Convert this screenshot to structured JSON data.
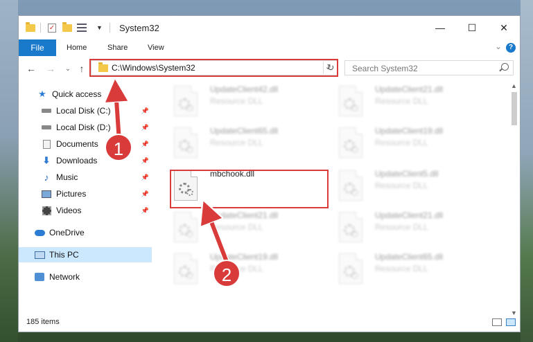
{
  "window": {
    "title": "System32",
    "minimize": "—",
    "maximize": "☐",
    "close": "✕"
  },
  "ribbon": {
    "file": "File",
    "home": "Home",
    "share": "Share",
    "view": "View",
    "help": "?"
  },
  "nav": {
    "address": "C:\\Windows\\System32",
    "search_placeholder": "Search System32"
  },
  "sidebar": {
    "items": [
      {
        "label": "Quick access",
        "icon": "star-icon"
      },
      {
        "label": "Local Disk (C:)",
        "icon": "drive-icon",
        "pinned": true
      },
      {
        "label": "Local Disk (D:)",
        "icon": "drive-icon",
        "pinned": true
      },
      {
        "label": "Documents",
        "icon": "documents-icon",
        "pinned": true
      },
      {
        "label": "Downloads",
        "icon": "download-icon",
        "pinned": true
      },
      {
        "label": "Music",
        "icon": "music-icon",
        "pinned": true
      },
      {
        "label": "Pictures",
        "icon": "pictures-icon",
        "pinned": true
      },
      {
        "label": "Videos",
        "icon": "videos-icon",
        "pinned": true
      },
      {
        "label": "OneDrive",
        "icon": "cloud-icon"
      },
      {
        "label": "This PC",
        "icon": "pc-icon",
        "selected": true
      },
      {
        "label": "Network",
        "icon": "network-icon"
      }
    ]
  },
  "files": [
    {
      "name": "UpdateClient42.dll",
      "type": "Resource DLL"
    },
    {
      "name": "UpdateClient21.dll",
      "type": "Resource DLL"
    },
    {
      "name": "UpdateClient65.dll",
      "type": "Resource DLL"
    },
    {
      "name": "UpdateClient19.dll",
      "type": "Resource DLL"
    },
    {
      "name": "mbchook.dll",
      "type": ""
    },
    {
      "name": "UpdateClient5.dll",
      "type": "Resource DLL"
    },
    {
      "name": "UpdateClient21.dll",
      "type": "Resource DLL"
    },
    {
      "name": "UpdateClient21.dll",
      "type": "Resource DLL"
    },
    {
      "name": "UpdateClient19.dll",
      "type": "Resource DLL"
    },
    {
      "name": "UpdateClient65.dll",
      "type": "Resource DLL"
    }
  ],
  "status": {
    "count": "185 items"
  },
  "annotations": {
    "step1": "1",
    "step2": "2",
    "color": "#d93a3a"
  }
}
